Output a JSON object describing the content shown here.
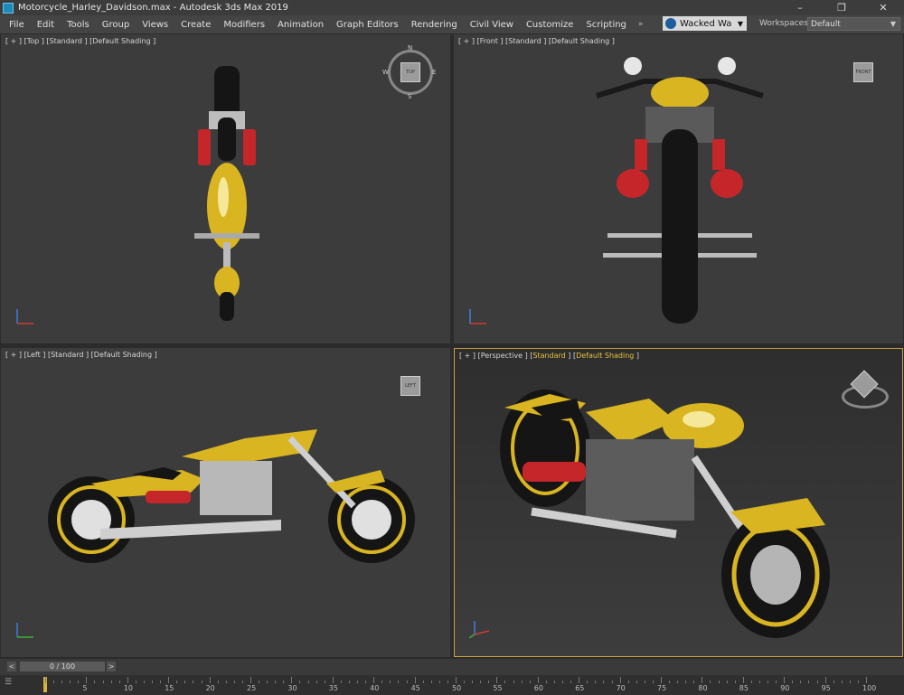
{
  "window": {
    "title": "Motorcycle_Harley_Davidson.max - Autodesk 3ds Max 2019",
    "controls": [
      "–",
      "❐",
      "✕"
    ]
  },
  "menu": {
    "items": [
      "File",
      "Edit",
      "Tools",
      "Group",
      "Views",
      "Create",
      "Modifiers",
      "Animation",
      "Graph Editors",
      "Rendering",
      "Civil View",
      "Customize",
      "Scripting"
    ],
    "more": "»"
  },
  "user": {
    "name": "Wacked Wa"
  },
  "workspace": {
    "label": "Workspaces:",
    "value": "Default"
  },
  "viewports": {
    "top": {
      "label": "[ + ] [Top ] [Standard ] [Default Shading ]",
      "cube_text": "TOP",
      "compass": {
        "n": "N",
        "s": "S",
        "e": "E",
        "w": "W"
      }
    },
    "front": {
      "label": "[ + ] [Front ] [Standard ] [Default Shading ]",
      "cube_text": "FRONT"
    },
    "left": {
      "label": "[ + ] [Left ] [Standard ] [Default Shading ]",
      "cube_text": "LEFT"
    },
    "perspective": {
      "label_prefix": "[ + ] [Perspective ] [",
      "label_standard": "Standard",
      "label_mid": " ] [",
      "label_shading": "Default Shading",
      "label_suffix": " ]"
    }
  },
  "timeline": {
    "frame": "0 / 100",
    "prev": "<",
    "next": ">"
  },
  "track": {
    "ticks": [
      "5",
      "10",
      "15",
      "20",
      "25",
      "30",
      "35",
      "40",
      "45",
      "50",
      "55",
      "60",
      "65",
      "70",
      "75",
      "80",
      "85",
      "90",
      "95",
      "100"
    ]
  },
  "colors": {
    "accent": "#e9c33c",
    "bike_yellow": "#d9b521",
    "tank_red": "#c4262a"
  }
}
